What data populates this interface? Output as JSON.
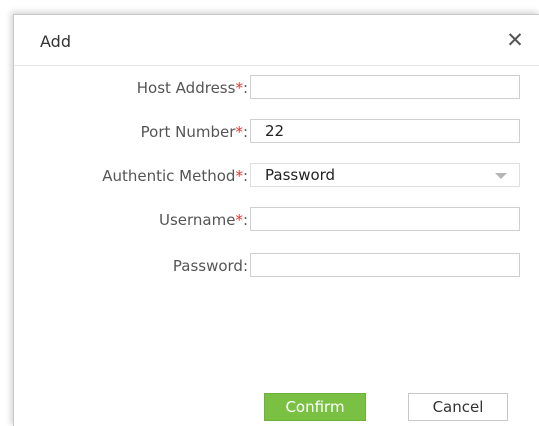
{
  "dialog": {
    "title": "Add",
    "close_glyph": "✕",
    "close_icon": "close-icon"
  },
  "form": {
    "host_address": {
      "label": "Host Address",
      "required_mark": "*",
      "colon": ":",
      "value": ""
    },
    "port_number": {
      "label": "Port Number",
      "required_mark": "*",
      "colon": ":",
      "value": "22"
    },
    "authentic_method": {
      "label": "Authentic Method",
      "required_mark": "*",
      "colon": ":",
      "selected": "Password",
      "icon": "chevron-down-icon"
    },
    "username": {
      "label": "Username",
      "required_mark": "*",
      "colon": ":",
      "value": ""
    },
    "password": {
      "label": "Password:",
      "value": ""
    }
  },
  "buttons": {
    "confirm": "Confirm",
    "cancel": "Cancel"
  },
  "colors": {
    "confirm_bg": "#7ac143",
    "required_mark": "#e0362f"
  }
}
